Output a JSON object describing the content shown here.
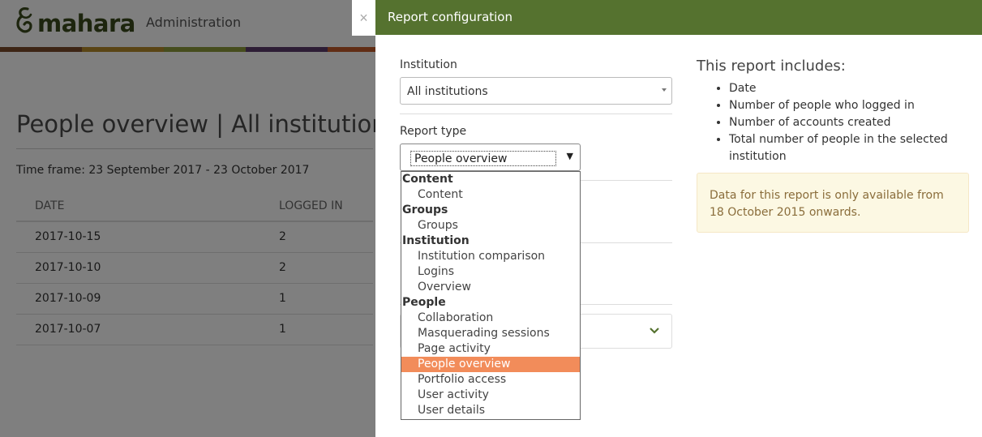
{
  "app": {
    "logo_text": "mahara",
    "admin_label": "Administration"
  },
  "background": {
    "page_title": "People overview | All institutions",
    "timeframe": "Time frame: 23 September 2017 - 23 October 2017",
    "table": {
      "headers": [
        "DATE",
        "LOGGED IN"
      ],
      "rows": [
        [
          "2017-10-15",
          "2"
        ],
        [
          "2017-10-10",
          "2"
        ],
        [
          "2017-10-09",
          "1"
        ],
        [
          "2017-10-07",
          "1"
        ]
      ]
    }
  },
  "modal": {
    "close_glyph": "×",
    "title": "Report configuration",
    "institution": {
      "label": "Institution",
      "value": "All institutions"
    },
    "report_type": {
      "label": "Report type",
      "value": "People overview",
      "arrow": "▼",
      "groups": [
        {
          "label": "Content",
          "options": [
            "Content"
          ]
        },
        {
          "label": "Groups",
          "options": [
            "Groups"
          ]
        },
        {
          "label": "Institution",
          "options": [
            "Institution comparison",
            "Logins",
            "Overview"
          ]
        },
        {
          "label": "People",
          "options": [
            "Collaboration",
            "Masquerading sessions",
            "Page activity",
            "People overview",
            "Portfolio access",
            "User activity",
            "User details"
          ]
        }
      ],
      "selected": "People overview"
    },
    "includes": {
      "title": "This report includes:",
      "items": [
        "Date",
        "Number of people who logged in",
        "Number of accounts created",
        "Total number of people in the selected institution"
      ]
    },
    "notice": "Data for this report is only available from 18 October 2015 onwards."
  },
  "colors": {
    "header_green": "#55722f",
    "selected_option": "#f28c5a",
    "notice_bg": "#fcf8e3",
    "notice_text": "#8a6d3b"
  }
}
